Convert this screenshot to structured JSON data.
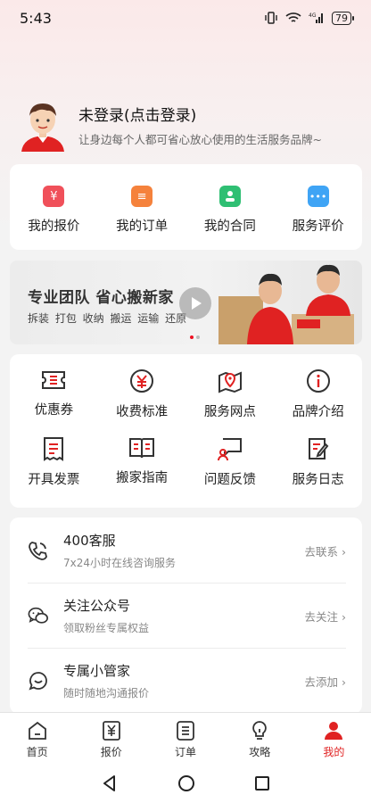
{
  "status": {
    "time": "5:43",
    "battery": "79"
  },
  "profile": {
    "login_text": "未登录(点击登录)",
    "slogan": "让身边每个人都可省心放心使用的生活服务品牌~"
  },
  "quick_actions": [
    {
      "label": "我的报价",
      "icon": "price-tag-icon",
      "color": "#f0505a",
      "glyph": "¥"
    },
    {
      "label": "我的订单",
      "icon": "order-list-icon",
      "color": "#f5823c",
      "glyph": "≡"
    },
    {
      "label": "我的合同",
      "icon": "contract-icon",
      "color": "#2fbf73",
      "glyph": "▲"
    },
    {
      "label": "服务评价",
      "icon": "chat-bubble-icon",
      "color": "#3fa4f5",
      "glyph": "···"
    }
  ],
  "banner": {
    "title": "专业团队 省心搬新家",
    "tags": "拆装 打包 收纳 搬运 运输 还原"
  },
  "services": [
    {
      "label": "优惠券",
      "icon": "coupon-icon"
    },
    {
      "label": "收费标准",
      "icon": "fee-standard-icon"
    },
    {
      "label": "服务网点",
      "icon": "location-map-icon"
    },
    {
      "label": "品牌介绍",
      "icon": "info-icon"
    },
    {
      "label": "开具发票",
      "icon": "invoice-icon"
    },
    {
      "label": "搬家指南",
      "icon": "guide-book-icon"
    },
    {
      "label": "问题反馈",
      "icon": "feedback-icon"
    },
    {
      "label": "服务日志",
      "icon": "service-log-icon"
    }
  ],
  "contacts": [
    {
      "title": "400客服",
      "subtitle": "7x24小时在线咨询服务",
      "action": "去联系",
      "icon": "phone-icon"
    },
    {
      "title": "关注公众号",
      "subtitle": "领取粉丝专属权益",
      "action": "去关注",
      "icon": "wechat-icon"
    },
    {
      "title": "专属小管家",
      "subtitle": "随时随地沟通报价",
      "action": "去添加",
      "icon": "chat-smile-icon"
    }
  ],
  "tabs": [
    {
      "label": "首页",
      "icon": "home-icon"
    },
    {
      "label": "报价",
      "icon": "quote-icon"
    },
    {
      "label": "订单",
      "icon": "order-icon"
    },
    {
      "label": "攻略",
      "icon": "lightbulb-icon"
    },
    {
      "label": "我的",
      "icon": "person-icon",
      "active": true
    }
  ],
  "colors": {
    "accent": "#e02222",
    "background": "#f3f3f3"
  }
}
